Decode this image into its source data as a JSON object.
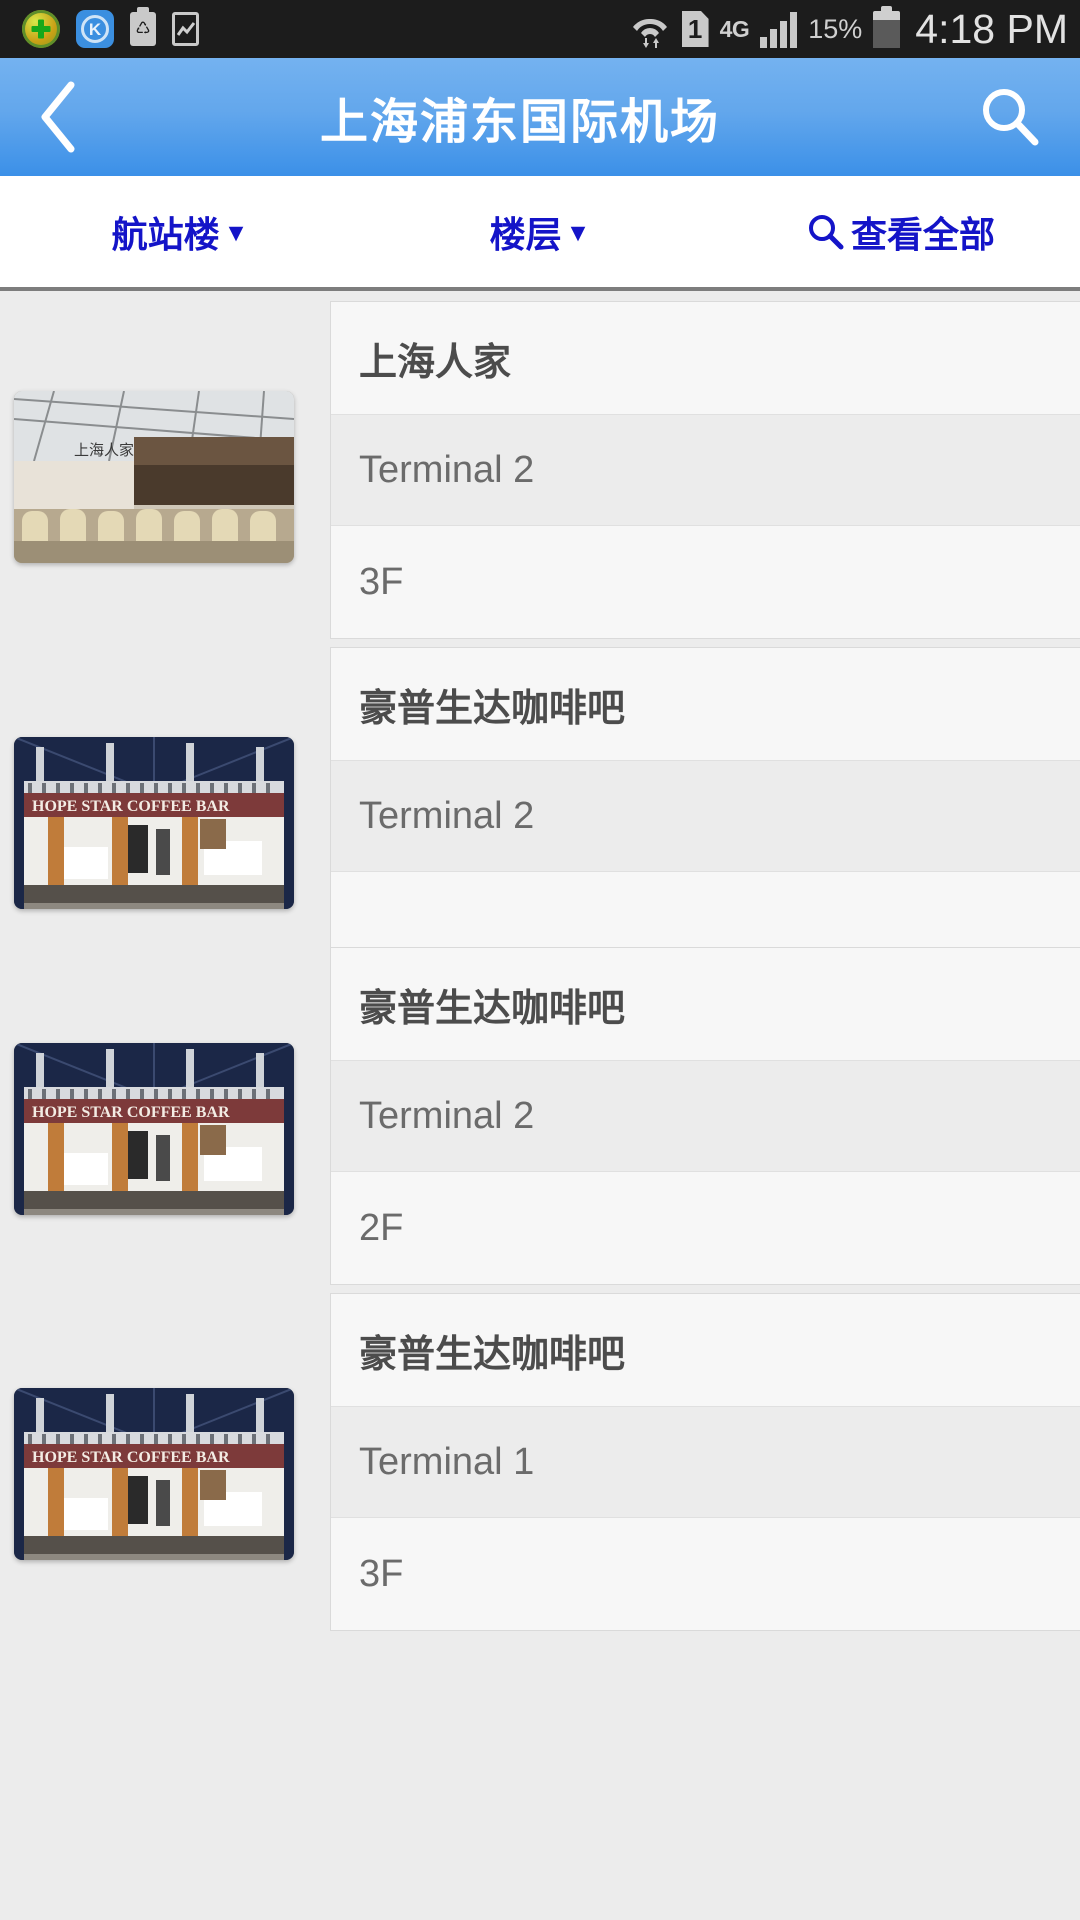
{
  "status_bar": {
    "icons_left": [
      "security-shield-icon",
      "kingsoft-k-icon",
      "recycle-bin-icon",
      "chart-box-icon"
    ],
    "wifi_icon": "wifi-icon",
    "sim_label": "1",
    "network_type": "4G",
    "signal_icon": "signal-bars-icon",
    "battery_percent": "15%",
    "battery_icon": "battery-icon",
    "time": "4:18 PM"
  },
  "app_bar": {
    "back_icon": "back-chevron-icon",
    "title": "上海浦东国际机场",
    "search_icon": "search-icon"
  },
  "filter_bar": {
    "terminal_label": "航站楼",
    "terminal_caret": "▼",
    "floor_label": "楼层",
    "floor_caret": "▼",
    "view_all_label": "查看全部",
    "view_all_icon": "search-icon"
  },
  "list": {
    "items": [
      {
        "name": "上海人家",
        "terminal": "Terminal 2",
        "floor": "3F",
        "thumb": "restaurant-interior-photo"
      },
      {
        "name": "豪普生达咖啡吧",
        "terminal": "Terminal 2",
        "floor": "",
        "thumb": "hope-star-coffee-bar-photo"
      },
      {
        "name": "豪普生达咖啡吧",
        "terminal": "Terminal 2",
        "floor": "2F",
        "thumb": "hope-star-coffee-bar-photo"
      },
      {
        "name": "豪普生达咖啡吧",
        "terminal": "Terminal 1",
        "floor": "3F",
        "thumb": "hope-star-coffee-bar-photo"
      }
    ]
  },
  "colors": {
    "app_bar_blue": "#63a7ec",
    "filter_text_blue": "#1414c8",
    "status_bar_bg": "#1c1c1c",
    "page_bg": "#ececec",
    "card_bg": "#f7f7f7",
    "row_alt_bg": "#ececec"
  }
}
